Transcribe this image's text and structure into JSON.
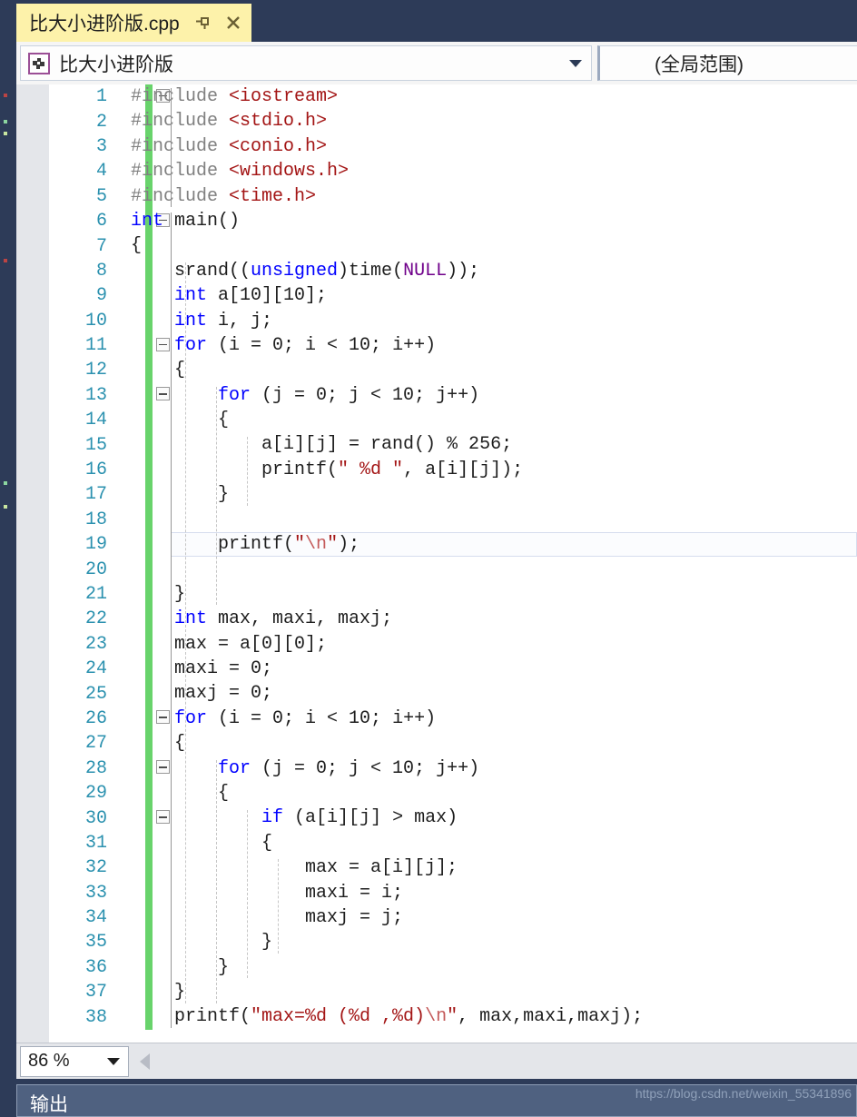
{
  "window": {
    "accent_dark": "#2D3B58",
    "tab_background": "#FDF2AA",
    "change_bar_color": "#68D36B"
  },
  "tab": {
    "title": "比大小进阶版.cpp",
    "pin_icon": "pin-icon",
    "close_icon": "close-icon"
  },
  "navbar": {
    "project_icon": "project-scope-icon",
    "scope_left": "比大小进阶版",
    "scope_right": "(全局范围)",
    "dropdown_icon": "chevron-down-icon"
  },
  "statusbar": {
    "zoom": "86 %",
    "zoom_dropdown_icon": "chevron-down-icon",
    "scroll_left_icon": "scroll-left-arrow-icon"
  },
  "output_panel": {
    "title": "输出"
  },
  "watermark": "https://blog.csdn.net/weixin_55341896",
  "editor": {
    "current_line": 19,
    "lines": [
      {
        "n": 1,
        "fold": "open",
        "indent": 0,
        "html": "<span class=\"pp\">#include </span><span class=\"hdr\">&lt;iostream&gt;</span>"
      },
      {
        "n": 2,
        "fold": null,
        "indent": 0,
        "html": "<span class=\"pp\">#include </span><span class=\"hdr\">&lt;stdio.h&gt;</span>"
      },
      {
        "n": 3,
        "fold": null,
        "indent": 0,
        "html": "<span class=\"pp\">#include </span><span class=\"hdr\">&lt;conio.h&gt;</span>"
      },
      {
        "n": 4,
        "fold": null,
        "indent": 0,
        "html": "<span class=\"pp\">#include </span><span class=\"hdr\">&lt;windows.h&gt;</span>"
      },
      {
        "n": 5,
        "fold": null,
        "indent": 0,
        "html": "<span class=\"pp\">#include </span><span class=\"hdr\">&lt;time.h&gt;</span>"
      },
      {
        "n": 6,
        "fold": "open",
        "indent": 0,
        "html": "<span class=\"kw\">int</span> main()"
      },
      {
        "n": 7,
        "fold": null,
        "indent": 0,
        "html": "{"
      },
      {
        "n": 8,
        "fold": null,
        "indent": 0,
        "html": "    srand((<span class=\"kw\">unsigned</span>)time(<span class=\"mac\">NULL</span>));"
      },
      {
        "n": 9,
        "fold": null,
        "indent": 0,
        "html": "    <span class=\"kw\">int</span> a[10][10];"
      },
      {
        "n": 10,
        "fold": null,
        "indent": 0,
        "html": "    <span class=\"kw\">int</span> i, j;"
      },
      {
        "n": 11,
        "fold": "open",
        "indent": 0,
        "html": "    <span class=\"kw\">for</span> (i = 0; i &lt; 10; i++)"
      },
      {
        "n": 12,
        "fold": null,
        "indent": 0,
        "html": "    {"
      },
      {
        "n": 13,
        "fold": "open",
        "indent": 0,
        "html": "        <span class=\"kw\">for</span> (j = 0; j &lt; 10; j++)"
      },
      {
        "n": 14,
        "fold": null,
        "indent": 0,
        "html": "        {"
      },
      {
        "n": 15,
        "fold": null,
        "indent": 0,
        "html": "            a[i][j] = rand() % 256;"
      },
      {
        "n": 16,
        "fold": null,
        "indent": 0,
        "html": "            printf(<span class=\"str\">\" %d \"</span>, a[i][j]);"
      },
      {
        "n": 17,
        "fold": null,
        "indent": 0,
        "html": "        }"
      },
      {
        "n": 18,
        "fold": null,
        "indent": 0,
        "html": ""
      },
      {
        "n": 19,
        "fold": null,
        "indent": 0,
        "html": "        printf(<span class=\"str\">\"</span><span class=\"esc\">\\n</span><span class=\"str\">\"</span>);"
      },
      {
        "n": 20,
        "fold": null,
        "indent": 0,
        "html": ""
      },
      {
        "n": 21,
        "fold": null,
        "indent": 0,
        "html": "    }"
      },
      {
        "n": 22,
        "fold": null,
        "indent": 0,
        "html": "    <span class=\"kw\">int</span> max, maxi, maxj;"
      },
      {
        "n": 23,
        "fold": null,
        "indent": 0,
        "html": "    max = a[0][0];"
      },
      {
        "n": 24,
        "fold": null,
        "indent": 0,
        "html": "    maxi = 0;"
      },
      {
        "n": 25,
        "fold": null,
        "indent": 0,
        "html": "    maxj = 0;"
      },
      {
        "n": 26,
        "fold": "open",
        "indent": 0,
        "html": "    <span class=\"kw\">for</span> (i = 0; i &lt; 10; i++)"
      },
      {
        "n": 27,
        "fold": null,
        "indent": 0,
        "html": "    {"
      },
      {
        "n": 28,
        "fold": "open",
        "indent": 0,
        "html": "        <span class=\"kw\">for</span> (j = 0; j &lt; 10; j++)"
      },
      {
        "n": 29,
        "fold": null,
        "indent": 0,
        "html": "        {"
      },
      {
        "n": 30,
        "fold": "open",
        "indent": 0,
        "html": "            <span class=\"kw\">if</span> (a[i][j] &gt; max)"
      },
      {
        "n": 31,
        "fold": null,
        "indent": 0,
        "html": "            {"
      },
      {
        "n": 32,
        "fold": null,
        "indent": 0,
        "html": "                max = a[i][j];"
      },
      {
        "n": 33,
        "fold": null,
        "indent": 0,
        "html": "                maxi = i;"
      },
      {
        "n": 34,
        "fold": null,
        "indent": 0,
        "html": "                maxj = j;"
      },
      {
        "n": 35,
        "fold": null,
        "indent": 0,
        "html": "            }"
      },
      {
        "n": 36,
        "fold": null,
        "indent": 0,
        "html": "        }"
      },
      {
        "n": 37,
        "fold": null,
        "indent": 0,
        "html": "    }"
      },
      {
        "n": 38,
        "fold": null,
        "indent": 0,
        "html": "    printf(<span class=\"str\">\"max=%d (%d ,%d)</span><span class=\"esc\">\\n</span><span class=\"str\">\"</span>, max,maxi,maxj);"
      }
    ]
  }
}
